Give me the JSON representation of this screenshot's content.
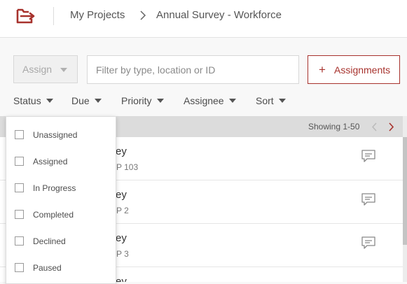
{
  "header": {
    "breadcrumb": {
      "projects": "My Projects",
      "current": "Annual Survey - Workforce"
    }
  },
  "toolbar": {
    "assign_label": "Assign",
    "filter_placeholder": "Filter by type, location or ID",
    "assignments_button": "Assignments"
  },
  "filters": [
    {
      "label": "Status"
    },
    {
      "label": "Due"
    },
    {
      "label": "Priority"
    },
    {
      "label": "Assignee"
    },
    {
      "label": "Sort"
    }
  ],
  "list": {
    "showing": "Showing 1-50",
    "rows": [
      {
        "title": "ey",
        "subtitle": "P 103"
      },
      {
        "title": "ey",
        "subtitle": "P 2"
      },
      {
        "title": "ey",
        "subtitle": "P 3"
      },
      {
        "title": "ey",
        "subtitle": ""
      }
    ]
  },
  "status_dropdown": {
    "options": [
      {
        "label": "Unassigned",
        "checked": false
      },
      {
        "label": "Assigned",
        "checked": false
      },
      {
        "label": "In Progress",
        "checked": false
      },
      {
        "label": "Completed",
        "checked": false
      },
      {
        "label": "Declined",
        "checked": false
      },
      {
        "label": "Paused",
        "checked": false
      }
    ]
  },
  "colors": {
    "brand": "#a7322d",
    "page_bg": "#f8f8f8",
    "list_header_bg": "#dcdcdc"
  },
  "icons": [
    "folder-logo-icon",
    "chevron-right-icon",
    "caret-down-icon",
    "plus-icon",
    "chevron-left-icon",
    "chat-icon"
  ]
}
